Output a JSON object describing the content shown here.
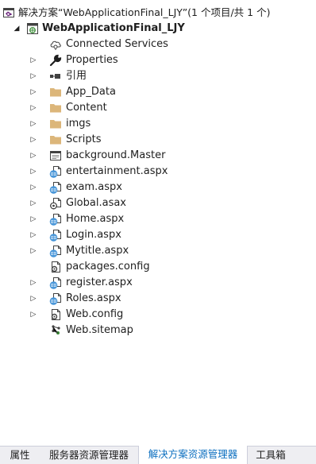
{
  "solution": {
    "label": "解决方案“WebApplicationFinal_LJY”(1 个项目/共 1 个)"
  },
  "project": {
    "name": "WebApplicationFinal_LJY"
  },
  "items": [
    {
      "label": "Connected Services",
      "icon": "connected-services-icon",
      "expandable": false
    },
    {
      "label": "Properties",
      "icon": "wrench-icon",
      "expandable": true
    },
    {
      "label": "引用",
      "icon": "references-icon",
      "expandable": true
    },
    {
      "label": "App_Data",
      "icon": "folder-icon",
      "expandable": true
    },
    {
      "label": "Content",
      "icon": "folder-icon",
      "expandable": true
    },
    {
      "label": "imgs",
      "icon": "folder-icon",
      "expandable": true
    },
    {
      "label": "Scripts",
      "icon": "folder-icon",
      "expandable": true
    },
    {
      "label": "background.Master",
      "icon": "master-page-icon",
      "expandable": true
    },
    {
      "label": "entertainment.aspx",
      "icon": "web-form-icon",
      "expandable": true
    },
    {
      "label": "exam.aspx",
      "icon": "web-form-icon",
      "expandable": true
    },
    {
      "label": "Global.asax",
      "icon": "global-asax-icon",
      "expandable": true
    },
    {
      "label": "Home.aspx",
      "icon": "web-form-icon",
      "expandable": true
    },
    {
      "label": "Login.aspx",
      "icon": "web-form-icon",
      "expandable": true
    },
    {
      "label": "Mytitle.aspx",
      "icon": "web-form-icon",
      "expandable": true
    },
    {
      "label": "packages.config",
      "icon": "config-icon",
      "expandable": false
    },
    {
      "label": "register.aspx",
      "icon": "web-form-icon",
      "expandable": true
    },
    {
      "label": "Roles.aspx",
      "icon": "web-form-icon",
      "expandable": true
    },
    {
      "label": "Web.config",
      "icon": "config-icon",
      "expandable": true
    },
    {
      "label": "Web.sitemap",
      "icon": "sitemap-icon",
      "expandable": false
    }
  ],
  "tabs": [
    {
      "label": "属性",
      "active": false
    },
    {
      "label": "服务器资源管理器",
      "active": false
    },
    {
      "label": "解决方案资源管理器",
      "active": true
    },
    {
      "label": "工具箱",
      "active": false
    }
  ],
  "colors": {
    "folder": "#dcb67a",
    "active_tab_text": "#0e70c0",
    "tab_bar": "#eeeef2",
    "web_globe": "#3c8fd6"
  }
}
